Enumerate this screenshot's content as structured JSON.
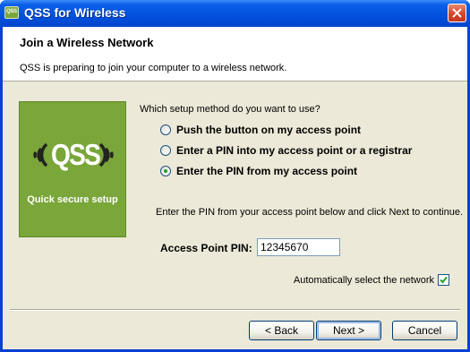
{
  "window": {
    "title": "QSS for Wireless",
    "icon": "qss-app-icon",
    "icon_text": "QSS"
  },
  "header": {
    "title": "Join a Wireless Network",
    "subtitle": "QSS is preparing to join your computer to a wireless network."
  },
  "banner": {
    "logo_text": "QSS",
    "tagline": "Quick secure setup",
    "color": "#7aa63a"
  },
  "question": "Which setup method do you want to use?",
  "options": [
    {
      "label": "Push the button on my access point",
      "checked": false
    },
    {
      "label": "Enter a PIN into my access point or a registrar",
      "checked": false
    },
    {
      "label": "Enter the PIN from my access point",
      "checked": true
    }
  ],
  "instruction": "Enter the PIN from your access point below and click Next to continue.",
  "pin": {
    "label": "Access Point PIN:",
    "value": "12345670"
  },
  "auto_select": {
    "label": "Automatically select the network",
    "checked": true
  },
  "buttons": {
    "back": "< Back",
    "next": "Next >",
    "cancel": "Cancel"
  }
}
